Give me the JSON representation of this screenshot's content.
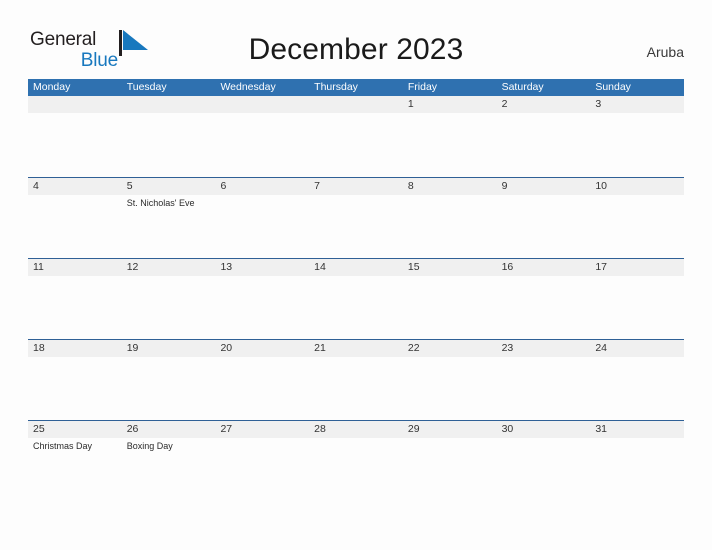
{
  "brand": {
    "name_part1": "General",
    "name_part2": "Blue",
    "flag_icon": "blue-triangle-flag-icon",
    "color_dark": "#231f20",
    "color_blue": "#1878be"
  },
  "header": {
    "title": "December 2023",
    "region": "Aruba"
  },
  "colors": {
    "header_bar": "#2f71b0",
    "row_divider": "#2f6096",
    "band": "#f0f0f0",
    "page_bg": "#fdfdfd"
  },
  "calendar": {
    "month": "December",
    "year": "2023",
    "weekday_headers": [
      "Monday",
      "Tuesday",
      "Wednesday",
      "Thursday",
      "Friday",
      "Saturday",
      "Sunday"
    ],
    "weeks": [
      {
        "days": [
          {
            "number": "",
            "events": []
          },
          {
            "number": "",
            "events": []
          },
          {
            "number": "",
            "events": []
          },
          {
            "number": "",
            "events": []
          },
          {
            "number": "1",
            "events": []
          },
          {
            "number": "2",
            "events": []
          },
          {
            "number": "3",
            "events": []
          }
        ]
      },
      {
        "days": [
          {
            "number": "4",
            "events": []
          },
          {
            "number": "5",
            "events": [
              "St. Nicholas' Eve"
            ]
          },
          {
            "number": "6",
            "events": []
          },
          {
            "number": "7",
            "events": []
          },
          {
            "number": "8",
            "events": []
          },
          {
            "number": "9",
            "events": []
          },
          {
            "number": "10",
            "events": []
          }
        ]
      },
      {
        "days": [
          {
            "number": "11",
            "events": []
          },
          {
            "number": "12",
            "events": []
          },
          {
            "number": "13",
            "events": []
          },
          {
            "number": "14",
            "events": []
          },
          {
            "number": "15",
            "events": []
          },
          {
            "number": "16",
            "events": []
          },
          {
            "number": "17",
            "events": []
          }
        ]
      },
      {
        "days": [
          {
            "number": "18",
            "events": []
          },
          {
            "number": "19",
            "events": []
          },
          {
            "number": "20",
            "events": []
          },
          {
            "number": "21",
            "events": []
          },
          {
            "number": "22",
            "events": []
          },
          {
            "number": "23",
            "events": []
          },
          {
            "number": "24",
            "events": []
          }
        ]
      },
      {
        "days": [
          {
            "number": "25",
            "events": [
              "Christmas Day"
            ]
          },
          {
            "number": "26",
            "events": [
              "Boxing Day"
            ]
          },
          {
            "number": "27",
            "events": []
          },
          {
            "number": "28",
            "events": []
          },
          {
            "number": "29",
            "events": []
          },
          {
            "number": "30",
            "events": []
          },
          {
            "number": "31",
            "events": []
          }
        ]
      }
    ]
  }
}
